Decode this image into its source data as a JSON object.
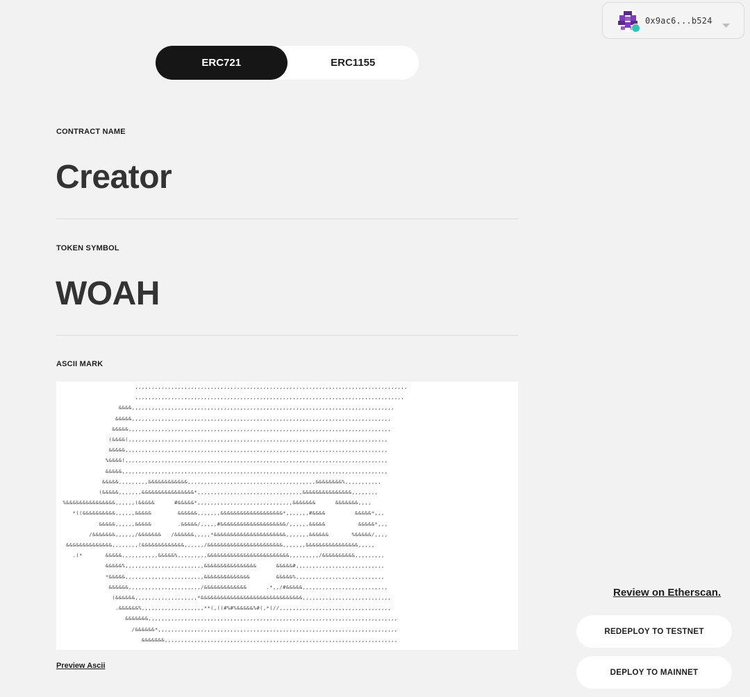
{
  "wallet": {
    "address": "0x9ac6...b524",
    "avatar_icon": "identicon-avatar",
    "status_color": "#2ec4b6"
  },
  "standards": {
    "options": [
      "ERC721",
      "ERC1155"
    ],
    "selected": "ERC721"
  },
  "contract": {
    "name_label": "CONTRACT NAME",
    "name_value": "Creator",
    "symbol_label": "TOKEN SYMBOL",
    "symbol_value": "WOAH"
  },
  "ascii": {
    "label": "ASCII MARK",
    "art": "                        ,,,,,,,,,,,,,,,,,,,,,,,,,,,,,,,,,,,,,,,,,,,,,,,,,,,,,,,,,,,,,,,,,,,,,,,,,,,,,,,,,,,\n                        ,,,,,,,,,,,,,,,,,,,,,,,,,,,,,,,,,,,,,,,,,,,,,,,,,,,,,,,,,,,,,,,,,,,,,,,,,,,,,,,,,,\n                   &&&&,,,,,,,,,,,,,,,,,,,,,,,,,,,,,,,,,,,,,,,,,,,,,,,,,,,,,,,,,,,,,,,,,,,,,,,,,,,,,,,,\n                  &&&&&,,,,,,,,,,,,,,,,,,,,,,,,,,,,,,,,,,,,,,,,,,,,,,,,,,,,,,,,,,,,,,,,,,,,,,,,,,,,,,,\n                 &&&&&,,,,,,,,,,,,,,,,,,,,,,,,,,,,,,,,,,,,,,,,,,,,,,,,,,,,,,,,,,,,,,,,,,,,,,,,,,,,,,,,\n                (&&&&(,,,,,,,,,,,,,,,,,,,,,,,,,,,,,,,,,,,,,,,,,,,,,,,,,,,,,,,,,,,,,,,,,,,,,,,,,,,,,,,\n                &&&&&,,,,,,,,,,,,,,,,,,,,,,,,,,,,,,,,,,,,,,,,,,,,,,,,,,,,,,,,,,,,,,,,,,,,,,,,,,,,,,,,\n               %&&&&(,,,,,,,,,,,,,,,,,,,,,,,,,,,,,,,,,,,,,,,,,,,,,,,,,,,,,,,,,,,,,,,,,,,,,,,,,,,,,,,,\n               &&&&&,,,,,,,,,,,,,,,,,,,,,,,,,,,,,,,,,,,,,,,,,,,,,,,,,,,,,,,,,,,,,,,,,,,,,,,,,,,,,,,,,\n              &&&&&,,,,,,,,,&&&&&&&&&&&&,,,,,,,,,,,,,,,,,,,,,,,,,,,,,,,,,,,,,,,&&&&&&&&%,,,,,,,,,,,\n             (&&&&&,,,,,,,&&&&&&&&&&&&&&&&*,,,,,,,,,,,,,,,,,,,,,,,,,,,,,,,,&&&&&&&&&&&&&&&,,,,,,,,\n  %&&&&&&&&&&&&&&&,,,,,,(&&&&&      #&&&&&*,,,,,,,,,,,,,,,,,,,,,,,,,,,,,&&&&&&&      &&&&&&&,,,,\n     *((&&&&&&&&&&,,,,,,&&&&&        &&&&&&,,,,,,,&&&&&&&&&&&&&&&&&&&*,,,,,,,#&&&&         &&&&&*,,,\n             &&&&&,,,,,,&&&&&        .&&&&&/,,,,,#&&&&&&&&&&&&&&&&&&&&/,,,,,,&&&&&          &&&&&*,,,\n          /&&&&&&&,,,,,,/&&&&&&&   /&&&&&&,,,,,*&&&&&&&&&&&&&&&&&&&&&&,,,,,,,&&&&&&       %&&&&&/,,,,\n   &&&&&&&&&&&&&&,,,,,,,,(&&&&&&&&&&&&&,,,,,,/&&&&&&&&&&&&&&&&&&&&&&&,,,,,,,&&&&&&&&&&&&&&&&,,,,,\n     .(*       &&&&&,,,,,,,,,,,&&&&&%,,,,,,,,,&&&&&&&&&&&&&&&&&&&&&&&&&,,,,,,,,,/&&&&&&&&&&,,,,,,,,,\n               &&&&&%,,,,,,,,,,,,,,,,,,,,,,,,&&&&&&&&&&&&&&&&      &&&&&#,,,,,,,,,,,,,,,,,,,,,,,,,,,\n               *&&&&&,,,,,,,,,,,,,,,,,,,,,,,,&&&&&&&&&&&&&&        &&&&&%,,,,,,,,,,,,,,,,,,,,,,,,,,,\n                &&&&&&,,,,,,,,,,,,,,,,,,,,,,/&&&&&&&&&&&&&      .*,,/#&&&&&,,,,,,,,,,,,,,,,,,,,,,,,,,\n                 (&&&&&&,,,,,,,,,,,,,,,,,,,*&&&&&&&&&&&&&&&&&&&&&&&&&&&&&&&,,,,,,,,,,,,,,,,,,,,,,,,,,,\n                  .&&&&&&%,,,,,,,,,,,,,,,,,,,**(,((#%#%&&&&&%#(,*(//,,,,,,,,,,,,,,,,,,,,,,,,,,,,,,,,,,\n                     &&&&&&&,,,,,,,,,,,,,,,,,,,,,,,,,,,,,,,,,,,,,,,,,,,,,,,,,,,,,,,,,,,,,,,,,,,,,,,,,,,,\n                       /&&&&&&*,,,,,,,,,,,,,,,,,,,,,,,,,,,,,,,,,,,,,,,,,,,,,,,,,,,,,,,,,,,,,,,,,,,,,,,,,\n                          &&&&&&&,,,,,,,,,,,,,,,,,,,,,,,,,,,,,,,,,,,,,,,,,,,,,,,,,,,,,,,,,,,,,,,,,,,,,,,",
    "preview_label": "Preview Ascii"
  },
  "actions": {
    "etherscan_label": "Review on Etherscan.",
    "redeploy_label": "REDEPLOY TO TESTNET",
    "mainnet_label": "DEPLOY TO MAINNET"
  }
}
